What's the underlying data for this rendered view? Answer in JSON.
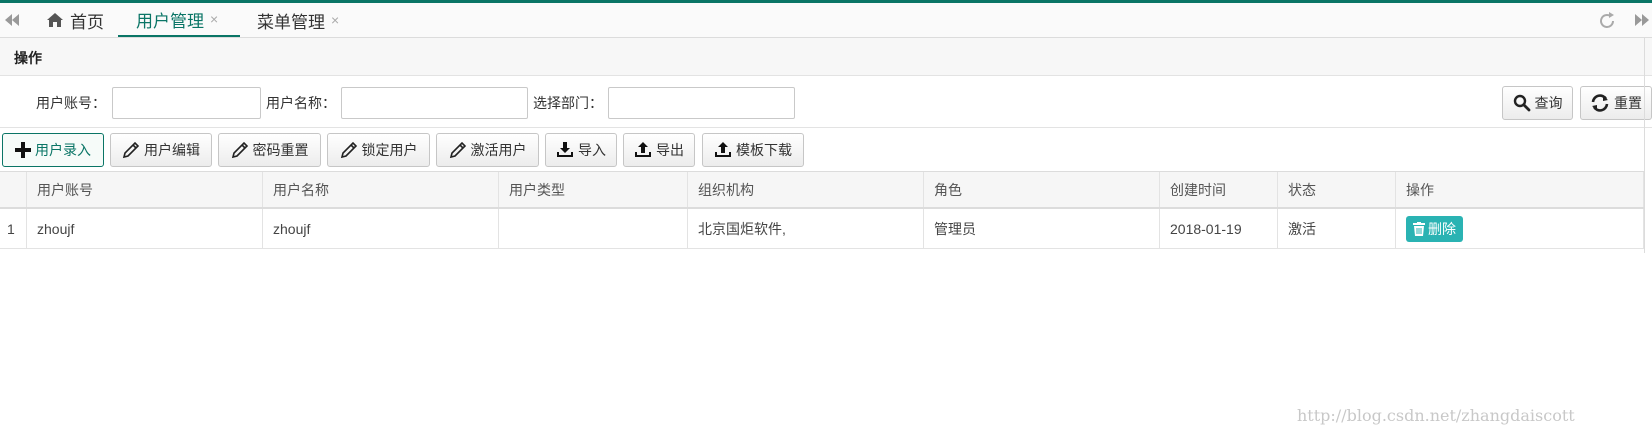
{
  "tabs": [
    {
      "label": "首页",
      "icon": "home-icon",
      "closable": false,
      "active": false
    },
    {
      "label": "用户管理",
      "closable": true,
      "active": true
    },
    {
      "label": "菜单管理",
      "closable": true,
      "active": false
    }
  ],
  "tab_close_glyph": "×",
  "accent_color": "#0a7566",
  "panel": {
    "title": "操作"
  },
  "search": {
    "account_label": "用户账号：",
    "account_value": "",
    "name_label": "用户名称：",
    "name_value": "",
    "dept_label": "选择部门：",
    "dept_value": "",
    "query_label": "查询",
    "reset_label": "重置"
  },
  "toolbar": {
    "add": "用户录入",
    "edit": "用户编辑",
    "reset_pwd": "密码重置",
    "lock": "锁定用户",
    "activate": "激活用户",
    "import": "导入",
    "export": "导出",
    "template": "模板下载"
  },
  "table": {
    "columns": [
      "用户账号",
      "用户名称",
      "用户类型",
      "组织机构",
      "角色",
      "创建时间",
      "状态",
      "操作"
    ],
    "rows": [
      {
        "index": "1",
        "account": "zhoujf",
        "name": "zhoujf",
        "type": "",
        "org": "北京国炬软件,",
        "role": "管理员",
        "created": "2018-01-19",
        "status": "激活",
        "action": "删除"
      }
    ],
    "delete_color": "#2ab3b3"
  },
  "watermark": "http://blog.csdn.net/zhangdaiscott"
}
